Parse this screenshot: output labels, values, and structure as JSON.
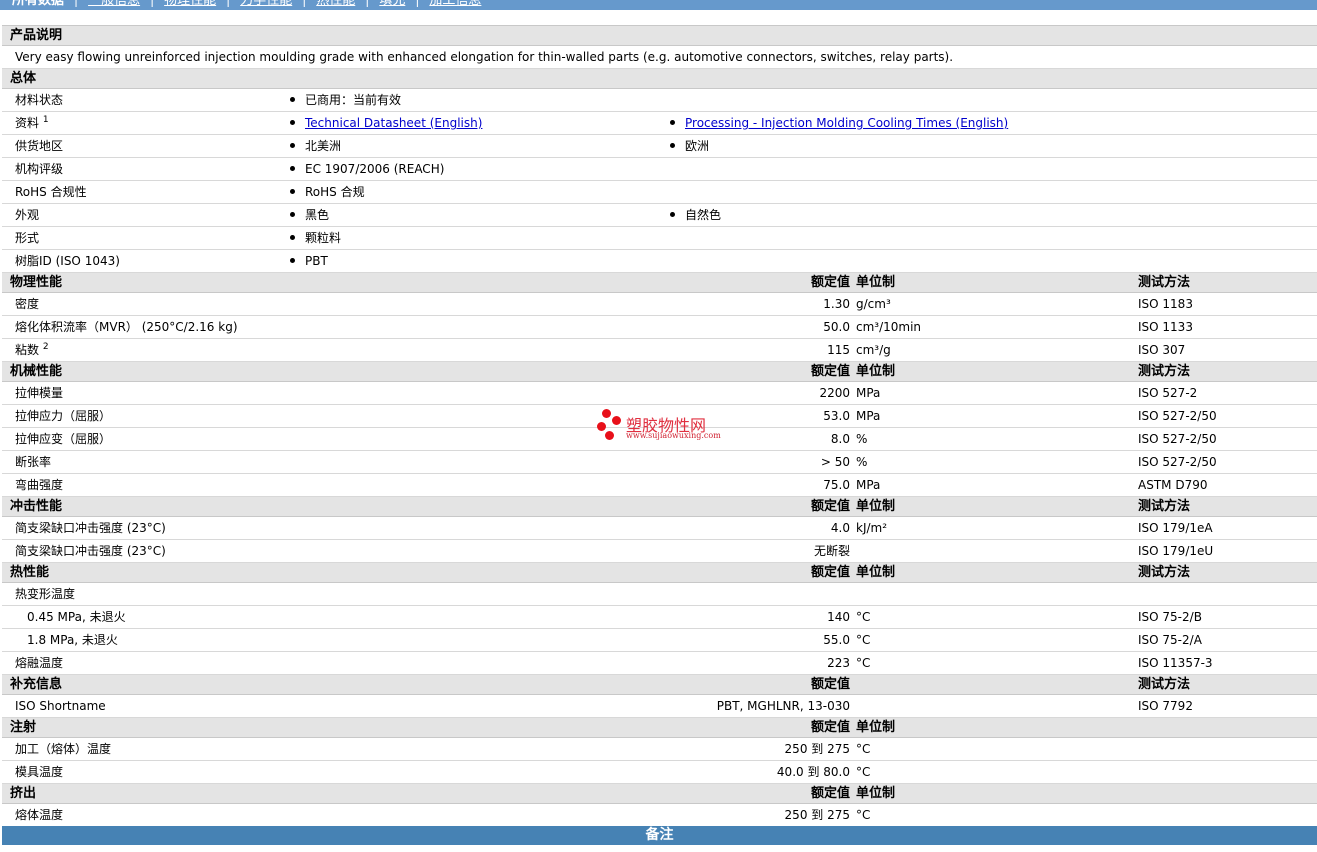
{
  "nav": [
    "所有数据",
    "一般信息",
    "物理性能",
    "力学性能",
    "热性能",
    "填充",
    "加工信息"
  ],
  "sections": [
    {
      "title": "产品说明",
      "rows": [
        {
          "type": "text",
          "text": "Very easy flowing unreinforced injection moulding grade with enhanced elongation for thin-walled parts (e.g. automotive connectors, switches, relay parts)."
        }
      ]
    },
    {
      "title": "总体",
      "rows": [
        {
          "type": "gen",
          "label": "材料状态",
          "b1": "已商用：当前有效"
        },
        {
          "type": "gen",
          "label": "资料",
          "sup": "1",
          "b1": "Technical Datasheet (English)",
          "b1link": true,
          "b2": "Processing - Injection Molding Cooling Times (English)",
          "b2link": true
        },
        {
          "type": "gen",
          "label": "供货地区",
          "b1": "北美洲",
          "b2": "欧洲"
        },
        {
          "type": "gen",
          "label": "机构评级",
          "b1": "EC 1907/2006 (REACH)"
        },
        {
          "type": "gen",
          "label": "RoHS 合规性",
          "b1": "RoHS 合规"
        },
        {
          "type": "gen",
          "label": "外观",
          "b1": "黑色",
          "b2": "自然色"
        },
        {
          "type": "gen",
          "label": "形式",
          "b1": "颗粒料"
        },
        {
          "type": "gen",
          "label": "树脂ID (ISO 1043)",
          "b1": "PBT"
        }
      ]
    },
    {
      "title": "物理性能",
      "h_val": "额定值",
      "h_unit": "单位制",
      "h_meth": "测试方法",
      "rows": [
        {
          "type": "prop",
          "label": "密度",
          "val": "1.30",
          "unit": "g/cm³",
          "meth": "ISO 1183"
        },
        {
          "type": "prop",
          "label": "熔化体积流率（MVR） (250°C/2.16 kg)",
          "val": "50.0",
          "unit": "cm³/10min",
          "meth": "ISO 1133"
        },
        {
          "type": "prop",
          "label": "粘数",
          "sup": "2",
          "val": "115",
          "unit": "cm³/g",
          "meth": "ISO 307"
        }
      ]
    },
    {
      "title": "机械性能",
      "h_val": "额定值",
      "h_unit": "单位制",
      "h_meth": "测试方法",
      "rows": [
        {
          "type": "prop",
          "label": "拉伸模量",
          "val": "2200",
          "unit": "MPa",
          "meth": "ISO 527-2"
        },
        {
          "type": "prop",
          "label": "拉伸应力（屈服）",
          "val": "53.0",
          "unit": "MPa",
          "meth": "ISO 527-2/50"
        },
        {
          "type": "prop",
          "label": "拉伸应变（屈服）",
          "val": "8.0",
          "unit": "%",
          "meth": "ISO 527-2/50"
        },
        {
          "type": "prop",
          "label": "断张率",
          "val": "> 50",
          "unit": "%",
          "meth": "ISO 527-2/50"
        },
        {
          "type": "prop",
          "label": "弯曲强度",
          "val": "75.0",
          "unit": "MPa",
          "meth": "ASTM D790"
        }
      ]
    },
    {
      "title": "冲击性能",
      "h_val": "额定值",
      "h_unit": "单位制",
      "h_meth": "测试方法",
      "rows": [
        {
          "type": "prop",
          "label": "简支梁缺口冲击强度 (23°C)",
          "val": "4.0",
          "unit": "kJ/m²",
          "meth": "ISO 179/1eA"
        },
        {
          "type": "prop",
          "label": "简支梁缺口冲击强度 (23°C)",
          "val": "无断裂",
          "unit": "",
          "meth": "ISO 179/1eU"
        }
      ]
    },
    {
      "title": "热性能",
      "h_val": "额定值",
      "h_unit": "单位制",
      "h_meth": "测试方法",
      "rows": [
        {
          "type": "prop",
          "label": "热变形温度",
          "val": "",
          "unit": "",
          "meth": ""
        },
        {
          "type": "prop",
          "label": "0.45 MPa, 未退火",
          "indent": true,
          "val": "140",
          "unit": "°C",
          "meth": "ISO 75-2/B"
        },
        {
          "type": "prop",
          "label": "1.8 MPa, 未退火",
          "indent": true,
          "val": "55.0",
          "unit": "°C",
          "meth": "ISO 75-2/A"
        },
        {
          "type": "prop",
          "label": "熔融温度",
          "val": "223",
          "unit": "°C",
          "meth": "ISO 11357-3"
        }
      ]
    },
    {
      "title": "补充信息",
      "h_val": "额定值",
      "h_meth": "测试方法",
      "rows": [
        {
          "type": "prop",
          "label": "ISO Shortname",
          "val": "PBT, MGHLNR, 13-030",
          "unit": "",
          "meth": "ISO 7792"
        }
      ]
    },
    {
      "title": "注射",
      "h_val": "额定值",
      "h_unit": "单位制",
      "rows": [
        {
          "type": "prop",
          "label": "加工（熔体）温度",
          "val": "250 到  275",
          "unit": "°C",
          "meth": ""
        },
        {
          "type": "prop",
          "label": "模具温度",
          "val": "40.0 到  80.0",
          "unit": "°C",
          "meth": ""
        }
      ]
    },
    {
      "title": "挤出",
      "h_val": "额定值",
      "h_unit": "单位制",
      "rows": [
        {
          "type": "prop",
          "label": "熔体温度",
          "val": "250 到  275",
          "unit": "°C",
          "meth": ""
        }
      ]
    }
  ],
  "notes_title": "备注",
  "watermark": {
    "title": "塑胶物性网",
    "url": "www.sujiaowuxing.com"
  }
}
